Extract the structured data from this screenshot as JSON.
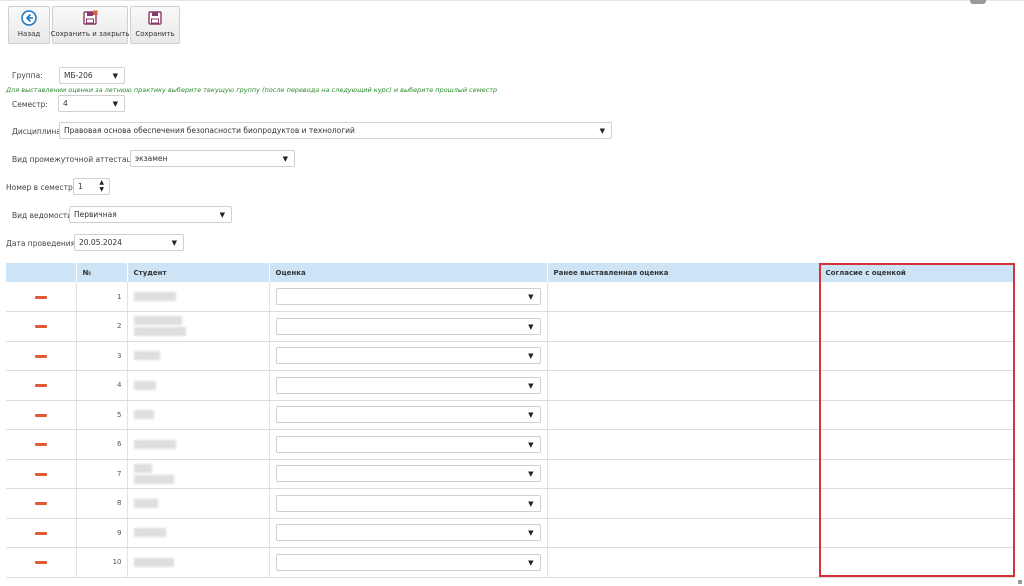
{
  "toolbar": {
    "back_label": "Назад",
    "save_close_label": "Сохранить и закрыть",
    "save_label": "Сохранить"
  },
  "form": {
    "group_label": "Группа:",
    "group_value": "МБ-206",
    "hint": "Для выставлении оценки за летнюю практику выберите текущую группу (после перевода на следующий курс) и выберите прошлый семестр",
    "semester_label": "Семестр:",
    "semester_value": "4",
    "discipline_label": "Дисциплина:",
    "discipline_value": "Правовая основа обеспечения безопасности биопродуктов и технологий",
    "attestation_label": "Вид промежуточной аттестации:",
    "attestation_value": "экзамен",
    "number_label": "Номер в семестре",
    "number_value": "1",
    "sheet_type_label": "Вид ведомости:",
    "sheet_type_value": "Первичная",
    "date_label": "Дата проведения:*",
    "date_value": "20.05.2024"
  },
  "grid": {
    "headers": {
      "num": "№",
      "student": "Студент",
      "grade": "Оценка",
      "prev_grade": "Ранее выставленная оценка",
      "agreement": "Согласие с оценкой"
    },
    "rows": [
      {
        "num": "1",
        "grade": "",
        "prev_grade": "",
        "agreement": ""
      },
      {
        "num": "2",
        "grade": "",
        "prev_grade": "",
        "agreement": ""
      },
      {
        "num": "3",
        "grade": "",
        "prev_grade": "",
        "agreement": ""
      },
      {
        "num": "4",
        "grade": "",
        "prev_grade": "",
        "agreement": ""
      },
      {
        "num": "5",
        "grade": "",
        "prev_grade": "",
        "agreement": ""
      },
      {
        "num": "6",
        "grade": "",
        "prev_grade": "",
        "agreement": ""
      },
      {
        "num": "7",
        "grade": "",
        "prev_grade": "",
        "agreement": ""
      },
      {
        "num": "8",
        "grade": "",
        "prev_grade": "",
        "agreement": ""
      },
      {
        "num": "9",
        "grade": "",
        "prev_grade": "",
        "agreement": ""
      },
      {
        "num": "10",
        "grade": "",
        "prev_grade": "",
        "agreement": ""
      }
    ]
  },
  "icons": {
    "back": "arrow-left-circle-icon",
    "save_close": "floppy-close-icon",
    "save": "floppy-icon",
    "dropdown": "chevron-down-icon",
    "delete": "minus-icon"
  },
  "colors": {
    "header_bg": "#cde4f6",
    "delete": "#e05a36",
    "highlight": "#d9313a",
    "hint": "#2b8a2b",
    "icon_primary": "#1e73be",
    "icon_save": "#8a3a6a"
  }
}
